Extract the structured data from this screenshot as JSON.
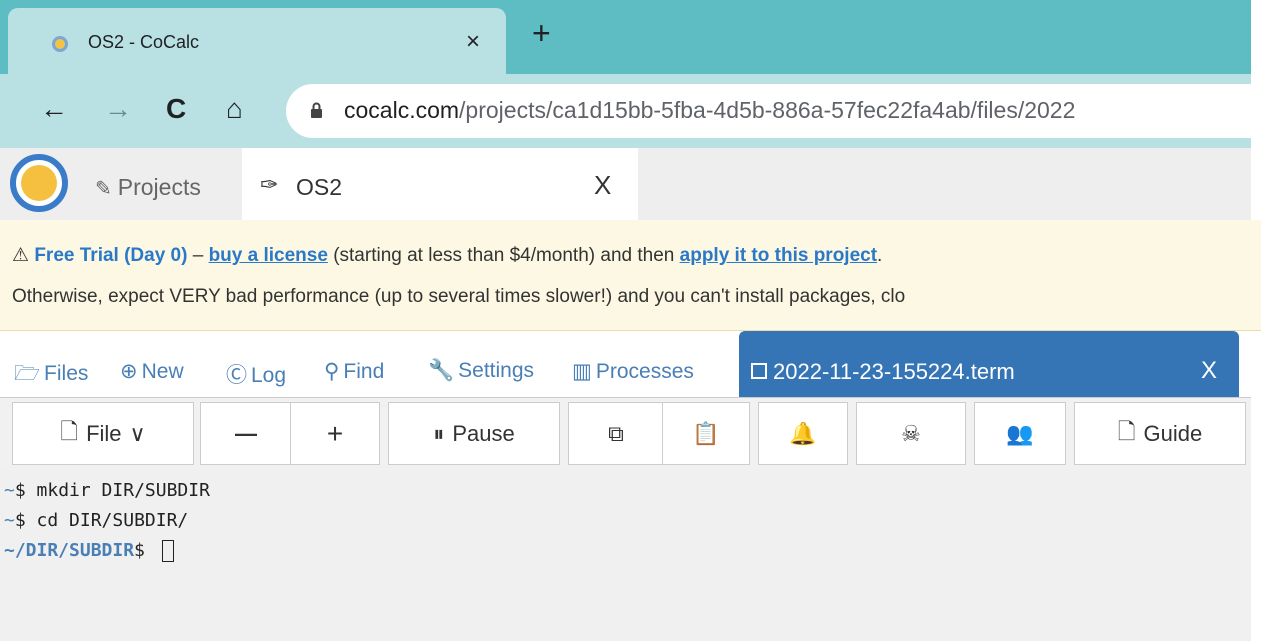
{
  "browser": {
    "tab_title": "OS2 - CoCalc",
    "tab_close": "×",
    "new_tab": "+",
    "url_host": "cocalc.com",
    "url_path": "/projects/ca1d15bb-5fba-4d5b-886a-57fec22fa4ab/files/2022",
    "nav_back": "←",
    "nav_forward": "→",
    "nav_reload": "C",
    "nav_home": "⌂"
  },
  "cocalc_top": {
    "projects_icon": "✎",
    "projects_label": "Projects",
    "project_tab_icon": "✑",
    "project_tab_label": "OS2",
    "project_tab_close": "X"
  },
  "banner": {
    "warning_icon": "⚠",
    "trial_label": "Free Trial (Day 0)",
    "dash": " – ",
    "buy_link": "buy a license",
    "mid_text": " (starting at less than $4/month) and then ",
    "apply_link": "apply it to this project",
    "end_text": ".",
    "line2": "Otherwise, expect VERY bad performance (up to several times slower!) and you can't install packages, clo"
  },
  "project_nav": {
    "files": {
      "icon": "🗁",
      "label": "Files"
    },
    "new": {
      "icon": "⊕",
      "label": "New"
    },
    "log": {
      "icon": "Ⓒ",
      "label": "Log"
    },
    "find": {
      "icon": "⚲",
      "label": "Find"
    },
    "settings": {
      "icon": "🔧",
      "label": "Settings"
    },
    "processes": {
      "icon": "▥",
      "label": "Processes"
    },
    "open_file_tab": {
      "label": "2022-11-23-155224.term",
      "close": "X"
    }
  },
  "terminal_toolbar": {
    "file_icon": "🗋",
    "file_label": "File",
    "file_chevron": "∨",
    "zoom_out": "—",
    "zoom_in": "+",
    "pause_icon": "⏸",
    "pause_label": "Pause",
    "copy_icon": "⧉",
    "paste_icon": "📋",
    "bell_icon": "🔔",
    "kill_icon": "☠",
    "users_icon": "👥",
    "guide_icon": "🗋",
    "guide_label": "Guide"
  },
  "terminal": {
    "lines": [
      {
        "prompt_tilde": "~",
        "prompt": "$ ",
        "command": "mkdir DIR/SUBDIR"
      },
      {
        "prompt_tilde": "~",
        "prompt": "$ ",
        "command": "cd DIR/SUBDIR/"
      }
    ],
    "current_prompt_path": "~/DIR/SUBDIR",
    "current_prompt_symbol": "$ "
  }
}
